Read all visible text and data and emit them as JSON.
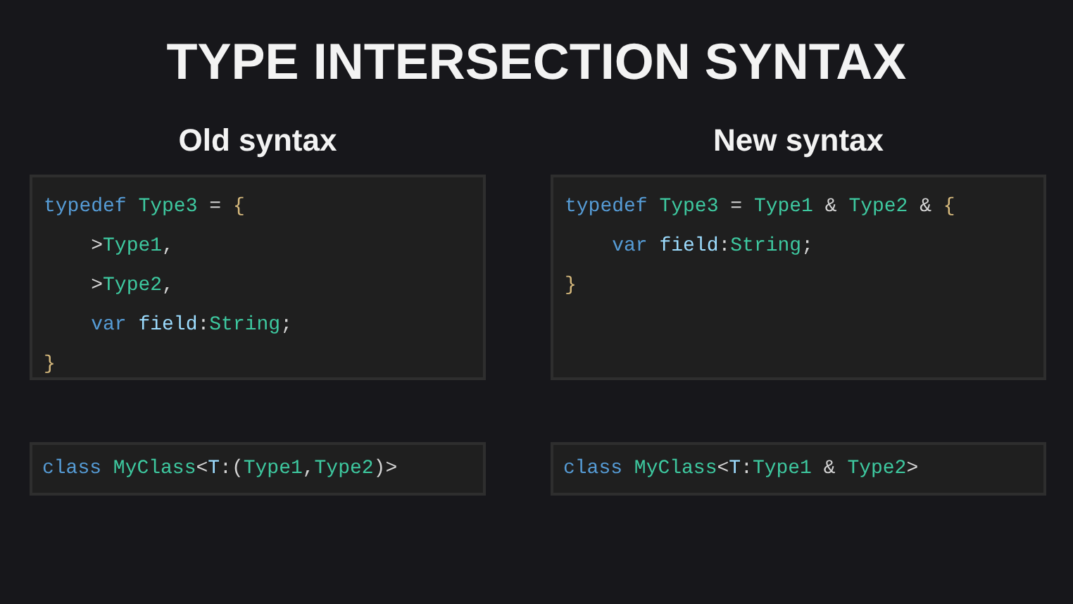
{
  "title": "TYPE INTERSECTION SYNTAX",
  "columns": [
    {
      "heading": "Old syntax",
      "code": [
        [
          {
            "text": "typedef ",
            "kind": "keyword"
          },
          {
            "text": "Type3",
            "kind": "type"
          },
          {
            "text": " = ",
            "kind": "punct"
          },
          {
            "text": "{",
            "kind": "brace"
          }
        ],
        [
          {
            "text": "    >",
            "kind": "punct"
          },
          {
            "text": "Type1",
            "kind": "type"
          },
          {
            "text": ",",
            "kind": "punct"
          }
        ],
        [
          {
            "text": "    >",
            "kind": "punct"
          },
          {
            "text": "Type2",
            "kind": "type"
          },
          {
            "text": ",",
            "kind": "punct"
          }
        ],
        [
          {
            "text": "    var ",
            "kind": "keyword"
          },
          {
            "text": "field",
            "kind": "ident"
          },
          {
            "text": ":",
            "kind": "punct"
          },
          {
            "text": "String",
            "kind": "type"
          },
          {
            "text": ";",
            "kind": "punct"
          }
        ],
        [
          {
            "text": "}",
            "kind": "brace"
          }
        ]
      ],
      "example": [
        {
          "text": "class ",
          "kind": "keyword"
        },
        {
          "text": "MyClass",
          "kind": "type"
        },
        {
          "text": "<",
          "kind": "punct"
        },
        {
          "text": "T",
          "kind": "ident"
        },
        {
          "text": ":(",
          "kind": "punct"
        },
        {
          "text": "Type1",
          "kind": "type"
        },
        {
          "text": ",",
          "kind": "punct"
        },
        {
          "text": "Type2",
          "kind": "type"
        },
        {
          "text": ")>",
          "kind": "punct"
        }
      ]
    },
    {
      "heading": "New syntax",
      "code": [
        [
          {
            "text": "typedef ",
            "kind": "keyword"
          },
          {
            "text": "Type3",
            "kind": "type"
          },
          {
            "text": " = ",
            "kind": "punct"
          },
          {
            "text": "Type1",
            "kind": "type"
          },
          {
            "text": " & ",
            "kind": "punct"
          },
          {
            "text": "Type2",
            "kind": "type"
          },
          {
            "text": " & ",
            "kind": "punct"
          },
          {
            "text": "{",
            "kind": "brace"
          }
        ],
        [
          {
            "text": "    var ",
            "kind": "keyword"
          },
          {
            "text": "field",
            "kind": "ident"
          },
          {
            "text": ":",
            "kind": "punct"
          },
          {
            "text": "String",
            "kind": "type"
          },
          {
            "text": ";",
            "kind": "punct"
          }
        ],
        [
          {
            "text": "}",
            "kind": "brace"
          }
        ]
      ],
      "example": [
        {
          "text": "class ",
          "kind": "keyword"
        },
        {
          "text": "MyClass",
          "kind": "type"
        },
        {
          "text": "<",
          "kind": "punct"
        },
        {
          "text": "T",
          "kind": "ident"
        },
        {
          "text": ":",
          "kind": "punct"
        },
        {
          "text": "Type1",
          "kind": "type"
        },
        {
          "text": " & ",
          "kind": "punct"
        },
        {
          "text": "Type2",
          "kind": "type"
        },
        {
          "text": ">",
          "kind": "punct"
        }
      ]
    }
  ]
}
